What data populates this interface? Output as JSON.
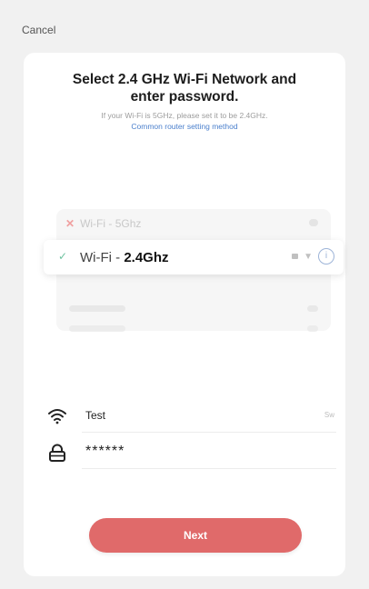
{
  "cancel_label": "Cancel",
  "title_line1": "Select 2.4 GHz Wi-Fi Network and",
  "title_line2": "enter password.",
  "hint_text": "If your Wi-Fi is 5GHz, please set it to be 2.4GHz.",
  "router_link_text": "Common router setting method",
  "unsupported_network": {
    "mark": "✕",
    "prefix": "Wi-Fi - ",
    "band": "5Ghz"
  },
  "supported_network": {
    "mark": "✓",
    "prefix": "Wi-Fi - ",
    "band": "2.4Ghz"
  },
  "ssid_value": "Test",
  "switch_network_text": "Sw",
  "password_value": "******",
  "next_label": "Next",
  "colors": {
    "next_button": "#e06a6a",
    "link": "#4a7fcc",
    "check": "#6fc2a0",
    "cross": "#f0a0a0"
  }
}
